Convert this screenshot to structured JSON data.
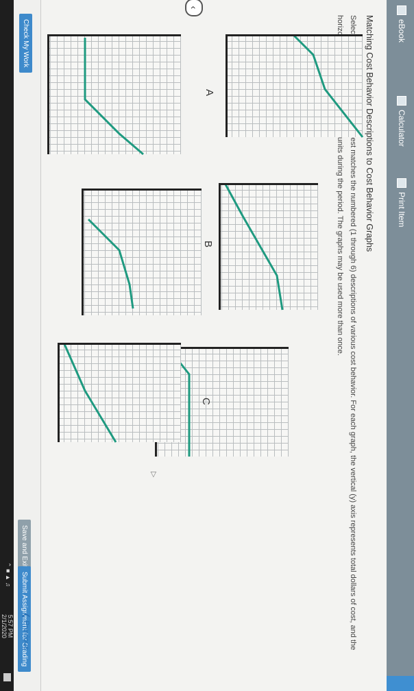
{
  "toolbar": {
    "ebook_label": "eBook",
    "calculator_label": "Calculator",
    "print_label": "Print Item"
  },
  "question": {
    "title": "Matching Cost Behavior Descriptions to Cost Behavior Graphs",
    "instructions": "Select the graph (A through K) that best matches the numbered (1 through 6) descriptions of various cost behavior. For each graph, the vertical (y) axis represents total dollars of cost, and the horizontal (x) axis represents output units during the period. The graphs may be used more than once."
  },
  "graphs": {
    "a_label": "A",
    "b_label": "B",
    "c_label": "C",
    "line_color": "#1f9a80"
  },
  "footer": {
    "check_label": "Check My Work",
    "previous_label": "Previous",
    "save_label": "Save and Exit",
    "submit_label": "Submit Assignment for Grading"
  },
  "taskbar": {
    "time": "5:57 PM",
    "date": "2/1/2020"
  }
}
